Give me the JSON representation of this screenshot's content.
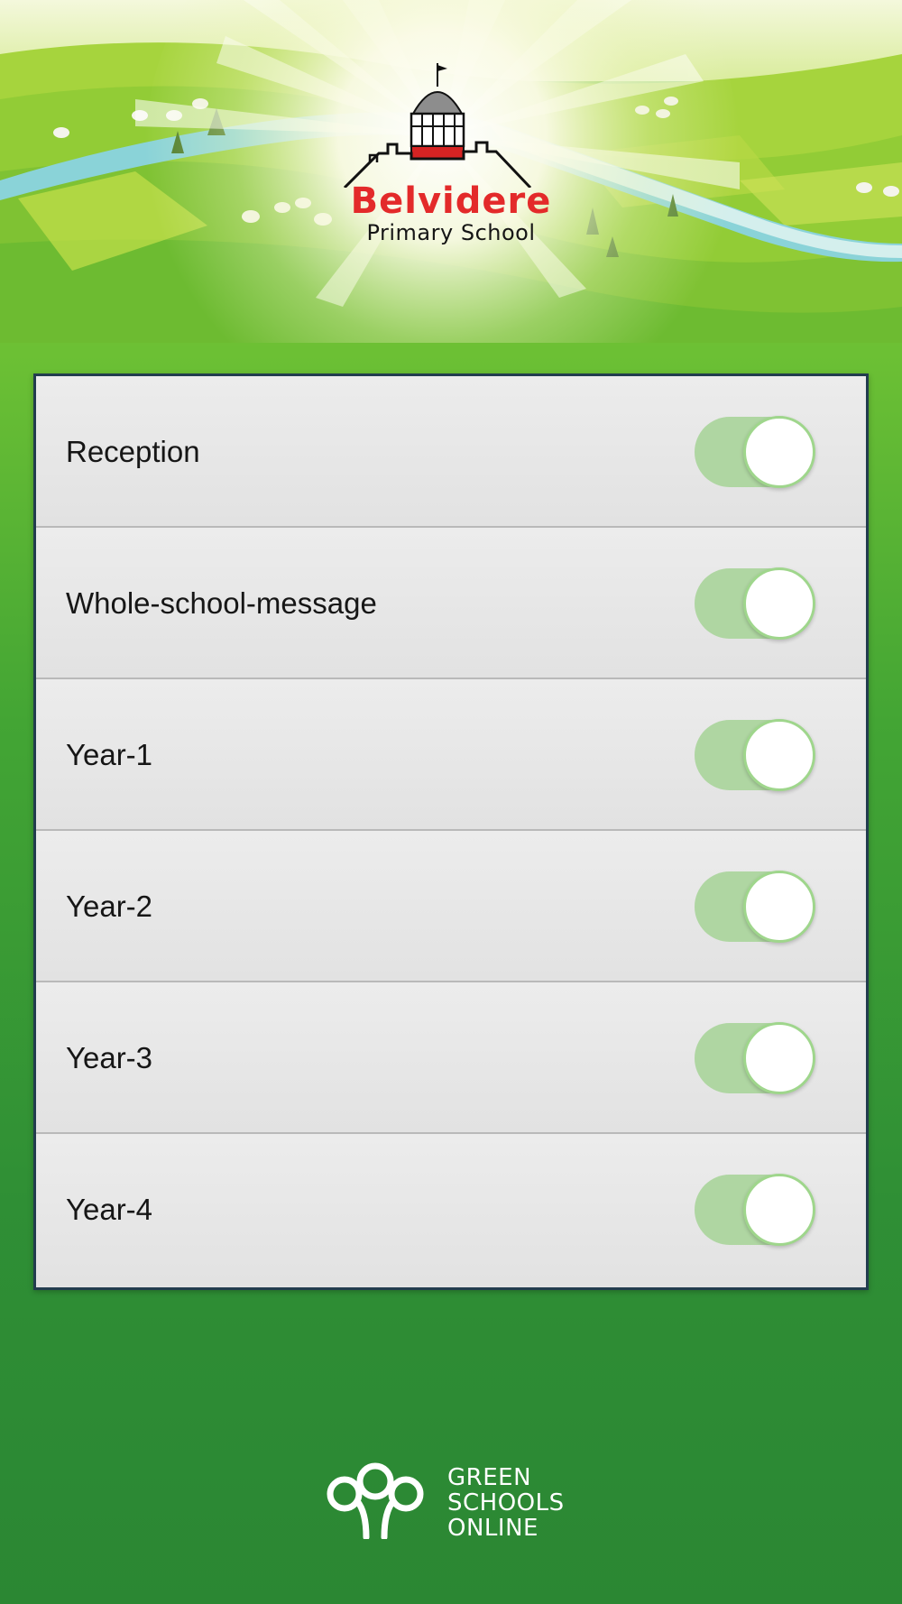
{
  "header": {
    "logo_title": "Belvidere",
    "logo_subtitle": "Primary School"
  },
  "channels": [
    {
      "label": "Reception",
      "enabled": true
    },
    {
      "label": "Whole-school-message",
      "enabled": true
    },
    {
      "label": "Year-1",
      "enabled": true
    },
    {
      "label": "Year-2",
      "enabled": true
    },
    {
      "label": "Year-3",
      "enabled": true
    },
    {
      "label": "Year-4",
      "enabled": true
    }
  ],
  "footer": {
    "brand_line1": "GREEN",
    "brand_line2": "SCHOOLS",
    "brand_line3": "ONLINE",
    "brand_icon": "tree-icon"
  },
  "colors": {
    "toggle_track_on": "#afd6a2",
    "toggle_knob_ring": "#9fd68c",
    "logo_red": "#e32a2a",
    "panel_border": "#223c4e",
    "background_green": "#2f8f35"
  }
}
